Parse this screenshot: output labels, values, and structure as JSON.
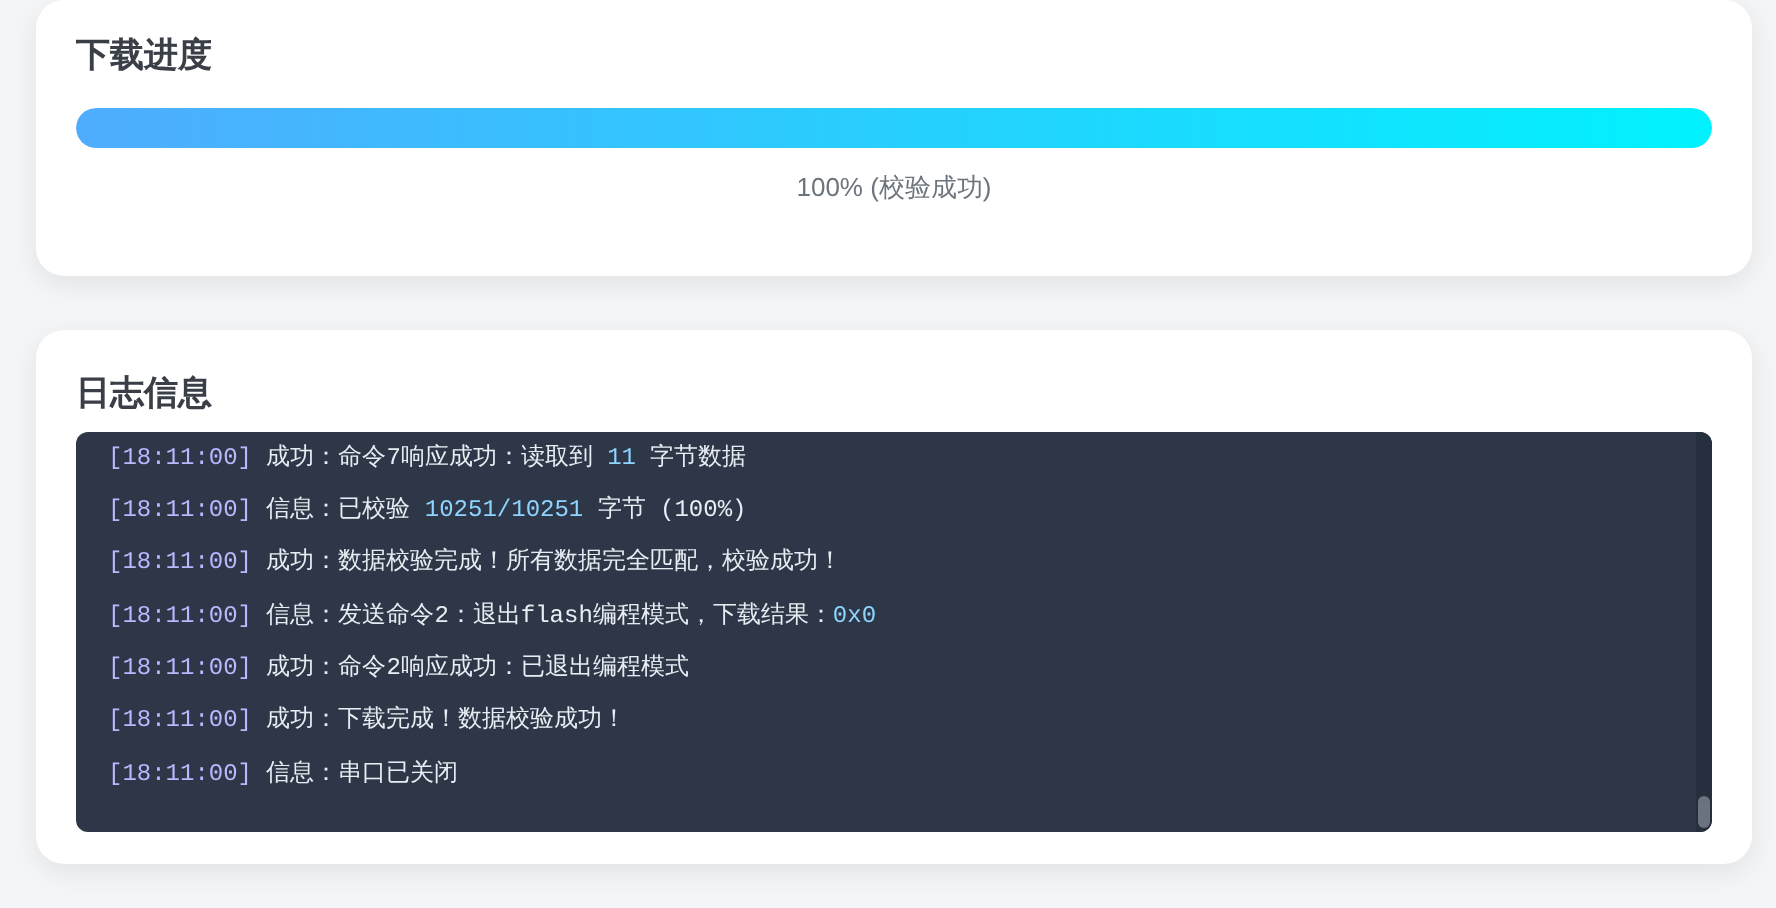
{
  "progress_card": {
    "title": "下载进度",
    "level": 1,
    "caption": "100% (校验成功)"
  },
  "log_card": {
    "title": "日志信息",
    "lines": [
      {
        "time": "[18:11:00]",
        "segments": [
          {
            "kind": "plain",
            "text": "成功：命令7响应成功：读取到 "
          },
          {
            "kind": "number",
            "text": "11"
          },
          {
            "kind": "plain",
            "text": " 字节数据"
          }
        ]
      },
      {
        "time": "[18:11:00]",
        "segments": [
          {
            "kind": "plain",
            "text": "信息：已校验 "
          },
          {
            "kind": "number",
            "text": "10251/10251"
          },
          {
            "kind": "plain",
            "text": " 字节 (100%)"
          }
        ]
      },
      {
        "time": "[18:11:00]",
        "segments": [
          {
            "kind": "plain",
            "text": "成功：数据校验完成！所有数据完全匹配，校验成功！"
          }
        ]
      },
      {
        "time": "[18:11:00]",
        "segments": [
          {
            "kind": "plain",
            "text": "信息：发送命令2：退出flash编程模式，下载结果："
          },
          {
            "kind": "number",
            "text": "0x0"
          }
        ]
      },
      {
        "time": "[18:11:00]",
        "segments": [
          {
            "kind": "plain",
            "text": "成功：命令2响应成功：已退出编程模式"
          }
        ]
      },
      {
        "time": "[18:11:00]",
        "segments": [
          {
            "kind": "plain",
            "text": "成功：下载完成！数据校验成功！"
          }
        ]
      },
      {
        "time": "[18:11:00]",
        "segments": [
          {
            "kind": "plain",
            "text": "信息：串口已关闭"
          }
        ]
      }
    ]
  }
}
